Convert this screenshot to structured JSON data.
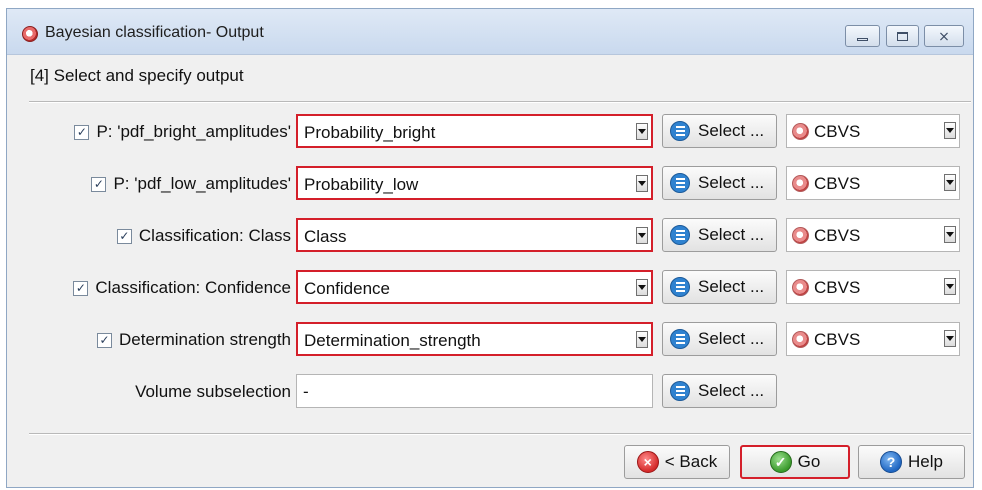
{
  "window": {
    "title": "Bayesian classification- Output",
    "close_glyph": "⨯"
  },
  "step_title": "[4] Select and specify output",
  "rows": [
    {
      "label": "P: 'pdf_bright_amplitudes'",
      "checked": true,
      "value": "Probability_bright",
      "select_label": "Select ...",
      "target": "CBVS"
    },
    {
      "label": "P: 'pdf_low_amplitudes'",
      "checked": true,
      "value": "Probability_low",
      "select_label": "Select ...",
      "target": "CBVS"
    },
    {
      "label": "Classification: Class",
      "checked": true,
      "value": "Class",
      "select_label": "Select ...",
      "target": "CBVS"
    },
    {
      "label": "Classification: Confidence",
      "checked": true,
      "value": "Confidence",
      "select_label": "Select ...",
      "target": "CBVS"
    },
    {
      "label": "Determination strength",
      "checked": true,
      "value": "Determination_strength",
      "select_label": "Select ...",
      "target": "CBVS"
    }
  ],
  "subselection": {
    "label": "Volume subselection",
    "value": "-",
    "select_label": "Select ..."
  },
  "footer": {
    "back_label": "< Back",
    "go_label": "Go",
    "help_label": "Help"
  },
  "checkmark": "✓",
  "icons": {
    "app": "bayesian-app-icon",
    "list": "list-select-icon",
    "cbvs": "cbvs-format-icon",
    "back": "cancel-x-icon",
    "go": "green-check-icon",
    "help": "question-icon"
  },
  "colors": {
    "highlight_border": "#d41f2a",
    "titlebar": "#c9d9ee",
    "select_icon": "#2f82d0"
  }
}
